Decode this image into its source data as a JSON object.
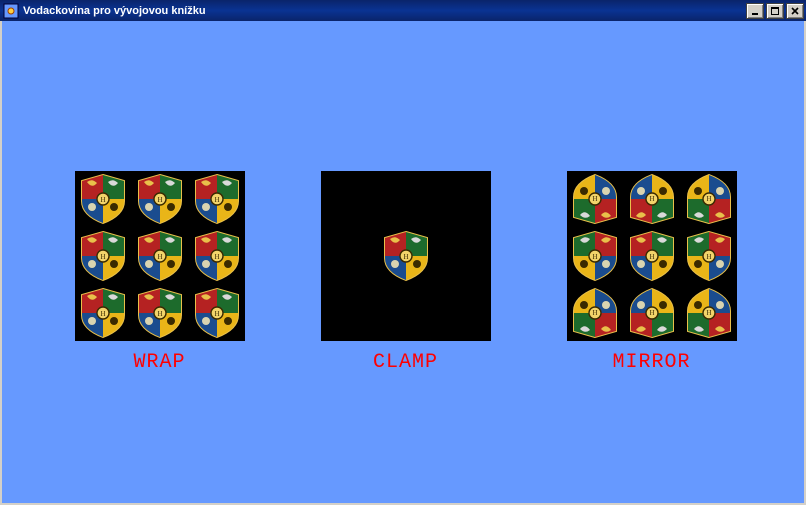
{
  "window": {
    "title": "Vodackovina pro vývojovou knížku"
  },
  "samples": [
    {
      "label": "WRAP"
    },
    {
      "label": "CLAMP"
    },
    {
      "label": "MIRROR"
    }
  ]
}
